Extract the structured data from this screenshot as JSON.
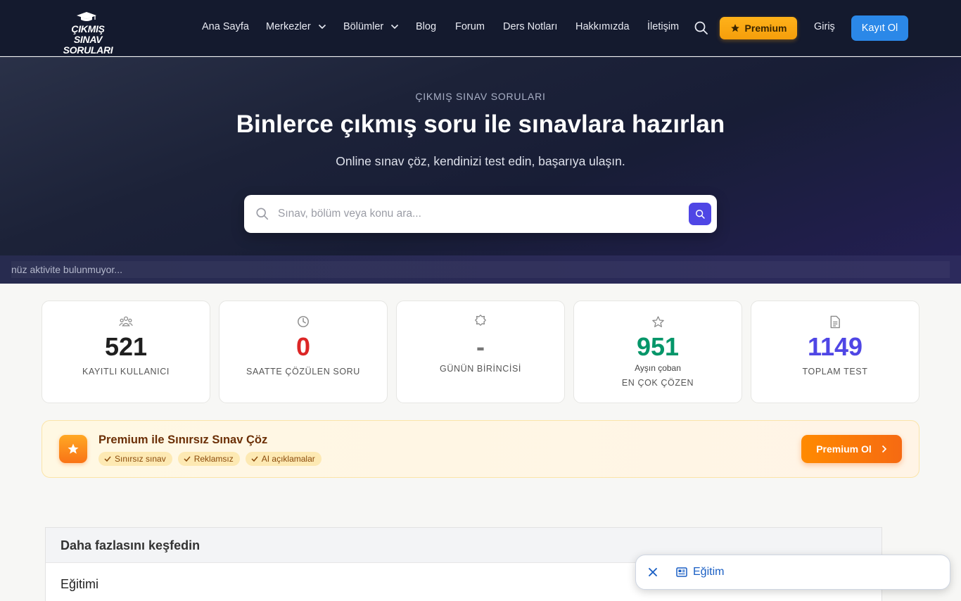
{
  "brand": {
    "logo_line1": "ÇIKMIŞ SINAV",
    "logo_line2": "SORULARI"
  },
  "nav": {
    "items": [
      "Ana Sayfa",
      "Merkezler",
      "Bölümler",
      "Blog",
      "Forum",
      "Ders Notları",
      "Hakkımızda",
      "İletişim"
    ],
    "premium_label": "Premium",
    "login_label": "Giriş",
    "register_label": "Kayıt Ol"
  },
  "hero": {
    "eyebrow": "ÇIKMIŞ SINAV SORULARI",
    "title": "Binlerce çıkmış soru ile sınavlara hazırlan",
    "subtitle": "Online sınav çöz, kendinizi test edin, başarıya ulaşın.",
    "search_placeholder": "Sınav, bölüm veya konu ara..."
  },
  "ticker": {
    "text": "nüz aktivite bulunmuyor..."
  },
  "stats": [
    {
      "value": "521",
      "label": "KAYITLI KULLANICI",
      "color": "#1f1f1f",
      "icon": "users-icon"
    },
    {
      "value": "0",
      "label": "SAATTE ÇÖZÜLEN SORU",
      "color": "#dc2626",
      "icon": "clock-icon"
    },
    {
      "value": "-",
      "label": "GÜNÜN BİRİNCİSİ",
      "color": "#777777",
      "icon": "award-icon"
    },
    {
      "value": "951",
      "sub": "Ayşın çoban",
      "label": "EN ÇOK ÇÖZEN",
      "color": "#059669",
      "icon": "star-icon"
    },
    {
      "value": "1149",
      "label": "TOPLAM TEST",
      "color": "#4f46e5",
      "icon": "document-icon"
    }
  ],
  "promo": {
    "title": "Premium ile Sınırsız Sınav Çöz",
    "tags": [
      "Sınırsız sınav",
      "Reklamsız",
      "AI açıklamalar"
    ],
    "button_label": "Premium Ol"
  },
  "explore": {
    "title": "Daha fazlasını keşfedin",
    "item": "Eğitimi"
  },
  "floating_chip": {
    "label": "Eğitim"
  }
}
